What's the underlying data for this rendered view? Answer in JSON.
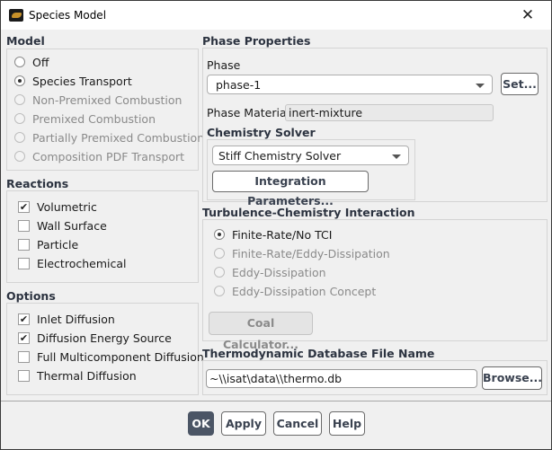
{
  "window": {
    "title": "Species Model",
    "close_label": "✕"
  },
  "model": {
    "heading": "Model",
    "options": [
      {
        "label": "Off",
        "selected": false,
        "enabled": true
      },
      {
        "label": "Species Transport",
        "selected": true,
        "enabled": true
      },
      {
        "label": "Non-Premixed Combustion",
        "selected": false,
        "enabled": false
      },
      {
        "label": "Premixed Combustion",
        "selected": false,
        "enabled": false
      },
      {
        "label": "Partially Premixed Combustion",
        "selected": false,
        "enabled": false
      },
      {
        "label": "Composition PDF Transport",
        "selected": false,
        "enabled": false
      }
    ]
  },
  "reactions": {
    "heading": "Reactions",
    "items": [
      {
        "label": "Volumetric",
        "checked": true
      },
      {
        "label": "Wall Surface",
        "checked": false
      },
      {
        "label": "Particle",
        "checked": false
      },
      {
        "label": "Electrochemical",
        "checked": false
      }
    ]
  },
  "options": {
    "heading": "Options",
    "items": [
      {
        "label": "Inlet Diffusion",
        "checked": true
      },
      {
        "label": "Diffusion Energy Source",
        "checked": true
      },
      {
        "label": "Full Multicomponent Diffusion",
        "checked": false
      },
      {
        "label": "Thermal Diffusion",
        "checked": false
      }
    ]
  },
  "phase_properties": {
    "heading": "Phase Properties",
    "phase_label": "Phase",
    "phase_value": "phase-1",
    "set_button": "Set...",
    "material_label": "Phase Material",
    "material_value": "inert-mixture"
  },
  "chemistry_solver": {
    "heading": "Chemistry Solver",
    "value": "Stiff Chemistry Solver",
    "integration_button": "Integration Parameters..."
  },
  "tci": {
    "heading": "Turbulence-Chemistry Interaction",
    "options": [
      {
        "label": "Finite-Rate/No TCI",
        "selected": true,
        "enabled": true
      },
      {
        "label": "Finite-Rate/Eddy-Dissipation",
        "selected": false,
        "enabled": false
      },
      {
        "label": "Eddy-Dissipation",
        "selected": false,
        "enabled": false
      },
      {
        "label": "Eddy-Dissipation Concept",
        "selected": false,
        "enabled": false
      }
    ],
    "coal_button": "Coal Calculator..."
  },
  "thermo_db": {
    "heading": "Thermodynamic Database File Name",
    "value": "~\\\\isat\\data\\\\thermo.db",
    "browse_button": "Browse..."
  },
  "footer": {
    "ok": "OK",
    "apply": "Apply",
    "cancel": "Cancel",
    "help": "Help"
  },
  "check_glyph": "✔"
}
